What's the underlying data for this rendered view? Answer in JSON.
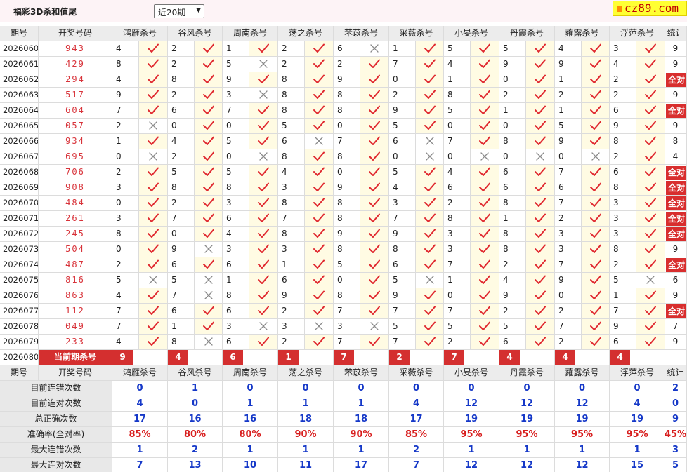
{
  "title": "福彩3D杀和值尾",
  "period_select": "近20期",
  "logo_text": "cz89.com",
  "headers": {
    "issue": "期号",
    "draw": "开奖号码",
    "experts": [
      "鸿雁杀号",
      "谷风杀号",
      "周南杀号",
      "荡之杀号",
      "芣苡杀号",
      "采薇杀号",
      "小旻杀号",
      "丹霞杀号",
      "蕹露杀号",
      "浮萍杀号"
    ],
    "stat": "统计"
  },
  "rows": [
    {
      "issue": "2026060",
      "draw": "943",
      "picks": [
        4,
        2,
        1,
        2,
        6,
        1,
        5,
        5,
        4,
        3
      ],
      "hits": [
        1,
        1,
        1,
        1,
        0,
        1,
        1,
        1,
        1,
        1
      ],
      "total": "9"
    },
    {
      "issue": "2026061",
      "draw": "429",
      "picks": [
        8,
        2,
        5,
        2,
        2,
        7,
        4,
        9,
        9,
        4
      ],
      "hits": [
        1,
        1,
        0,
        1,
        1,
        1,
        1,
        1,
        1,
        1
      ],
      "total": "9"
    },
    {
      "issue": "2026062",
      "draw": "294",
      "picks": [
        4,
        8,
        9,
        8,
        9,
        0,
        1,
        0,
        1,
        2
      ],
      "hits": [
        1,
        1,
        1,
        1,
        1,
        1,
        1,
        1,
        1,
        1
      ],
      "total": "全对"
    },
    {
      "issue": "2026063",
      "draw": "517",
      "picks": [
        9,
        2,
        3,
        8,
        8,
        2,
        8,
        2,
        2,
        2
      ],
      "hits": [
        1,
        1,
        0,
        1,
        1,
        1,
        1,
        1,
        1,
        1
      ],
      "total": "9"
    },
    {
      "issue": "2026064",
      "draw": "604",
      "picks": [
        7,
        6,
        7,
        8,
        8,
        9,
        5,
        1,
        1,
        6
      ],
      "hits": [
        1,
        1,
        1,
        1,
        1,
        1,
        1,
        1,
        1,
        1
      ],
      "total": "全对"
    },
    {
      "issue": "2026065",
      "draw": "057",
      "picks": [
        2,
        0,
        0,
        5,
        0,
        5,
        0,
        0,
        5,
        9
      ],
      "hits": [
        0,
        1,
        1,
        1,
        1,
        1,
        1,
        1,
        1,
        1
      ],
      "total": "9"
    },
    {
      "issue": "2026066",
      "draw": "934",
      "picks": [
        1,
        4,
        5,
        6,
        7,
        6,
        7,
        8,
        9,
        8
      ],
      "hits": [
        1,
        1,
        1,
        0,
        1,
        0,
        1,
        1,
        1,
        1
      ],
      "total": "8"
    },
    {
      "issue": "2026067",
      "draw": "695",
      "picks": [
        0,
        2,
        0,
        8,
        8,
        0,
        0,
        0,
        0,
        2
      ],
      "hits": [
        0,
        1,
        0,
        1,
        1,
        0,
        0,
        0,
        0,
        1
      ],
      "total": "4"
    },
    {
      "issue": "2026068",
      "draw": "706",
      "picks": [
        2,
        5,
        5,
        4,
        0,
        5,
        4,
        6,
        7,
        6
      ],
      "hits": [
        1,
        1,
        1,
        1,
        1,
        1,
        1,
        1,
        1,
        1
      ],
      "total": "全对"
    },
    {
      "issue": "2026069",
      "draw": "908",
      "picks": [
        3,
        8,
        8,
        3,
        9,
        4,
        6,
        6,
        6,
        8
      ],
      "hits": [
        1,
        1,
        1,
        1,
        1,
        1,
        1,
        1,
        1,
        1
      ],
      "total": "全对"
    },
    {
      "issue": "2026070",
      "draw": "484",
      "picks": [
        0,
        2,
        3,
        8,
        8,
        3,
        2,
        8,
        7,
        3
      ],
      "hits": [
        1,
        1,
        1,
        1,
        1,
        1,
        1,
        1,
        1,
        1
      ],
      "total": "全对"
    },
    {
      "issue": "2026071",
      "draw": "261",
      "picks": [
        3,
        7,
        6,
        7,
        8,
        7,
        8,
        1,
        2,
        3
      ],
      "hits": [
        1,
        1,
        1,
        1,
        1,
        1,
        1,
        1,
        1,
        1
      ],
      "total": "全对"
    },
    {
      "issue": "2026072",
      "draw": "245",
      "picks": [
        8,
        0,
        4,
        8,
        9,
        9,
        3,
        8,
        3,
        3
      ],
      "hits": [
        1,
        1,
        1,
        1,
        1,
        1,
        1,
        1,
        1,
        1
      ],
      "total": "全对"
    },
    {
      "issue": "2026073",
      "draw": "504",
      "picks": [
        0,
        9,
        3,
        3,
        8,
        8,
        3,
        8,
        3,
        8
      ],
      "hits": [
        1,
        0,
        1,
        1,
        1,
        1,
        1,
        1,
        1,
        1
      ],
      "total": "9"
    },
    {
      "issue": "2026074",
      "draw": "487",
      "picks": [
        2,
        6,
        6,
        1,
        5,
        6,
        7,
        2,
        7,
        2
      ],
      "hits": [
        1,
        1,
        1,
        1,
        1,
        1,
        1,
        1,
        1,
        1
      ],
      "total": "全对"
    },
    {
      "issue": "2026075",
      "draw": "816",
      "picks": [
        5,
        5,
        1,
        6,
        0,
        5,
        1,
        4,
        9,
        5
      ],
      "hits": [
        0,
        0,
        1,
        1,
        1,
        0,
        1,
        1,
        1,
        0
      ],
      "total": "6"
    },
    {
      "issue": "2026076",
      "draw": "863",
      "picks": [
        4,
        7,
        8,
        9,
        8,
        9,
        0,
        9,
        0,
        1
      ],
      "hits": [
        1,
        0,
        1,
        1,
        1,
        1,
        1,
        1,
        1,
        1
      ],
      "total": "9"
    },
    {
      "issue": "2026077",
      "draw": "112",
      "picks": [
        7,
        6,
        6,
        2,
        7,
        7,
        7,
        2,
        2,
        7
      ],
      "hits": [
        1,
        1,
        1,
        1,
        1,
        1,
        1,
        1,
        1,
        1
      ],
      "total": "全对"
    },
    {
      "issue": "2026078",
      "draw": "049",
      "picks": [
        7,
        1,
        3,
        3,
        3,
        5,
        5,
        5,
        7,
        9
      ],
      "hits": [
        1,
        1,
        0,
        0,
        0,
        1,
        1,
        1,
        1,
        1
      ],
      "total": "7"
    },
    {
      "issue": "2026079",
      "draw": "233",
      "picks": [
        4,
        8,
        6,
        2,
        7,
        7,
        2,
        6,
        2,
        6
      ],
      "hits": [
        1,
        0,
        1,
        1,
        1,
        1,
        1,
        1,
        1,
        1
      ],
      "total": "9"
    }
  ],
  "current": {
    "issue": "2026080",
    "label": "当前期杀号",
    "picks": [
      9,
      4,
      6,
      1,
      7,
      2,
      7,
      4,
      4,
      4
    ]
  },
  "stats": [
    {
      "label": "目前连错次数",
      "values": [
        "0",
        "1",
        "0",
        "0",
        "0",
        "0",
        "0",
        "0",
        "0",
        "0"
      ],
      "total": "2"
    },
    {
      "label": "目前连对次数",
      "values": [
        "4",
        "0",
        "1",
        "1",
        "1",
        "4",
        "12",
        "12",
        "12",
        "4"
      ],
      "total": "0"
    },
    {
      "label": "总正确次数",
      "values": [
        "17",
        "16",
        "16",
        "18",
        "18",
        "17",
        "19",
        "19",
        "19",
        "19"
      ],
      "total": "9"
    },
    {
      "label": "准确率(全对率)",
      "values": [
        "85%",
        "80%",
        "80%",
        "90%",
        "90%",
        "85%",
        "95%",
        "95%",
        "95%",
        "95%"
      ],
      "total": "45%",
      "pct": true
    },
    {
      "label": "最大连错次数",
      "values": [
        "1",
        "2",
        "1",
        "1",
        "1",
        "2",
        "1",
        "1",
        "1",
        "1"
      ],
      "total": "3"
    },
    {
      "label": "最大连对次数",
      "values": [
        "7",
        "13",
        "10",
        "11",
        "17",
        "7",
        "12",
        "12",
        "12",
        "15"
      ],
      "total": "5"
    }
  ],
  "colors": {
    "check": "#e0282f",
    "cross": "#8a8a8a",
    "badge": "#d82e2e",
    "stat_blue": "#1538c8",
    "stat_red": "#d81e1e"
  },
  "icons": {
    "hit": "check-mark-icon",
    "miss": "cross-mark-icon"
  }
}
